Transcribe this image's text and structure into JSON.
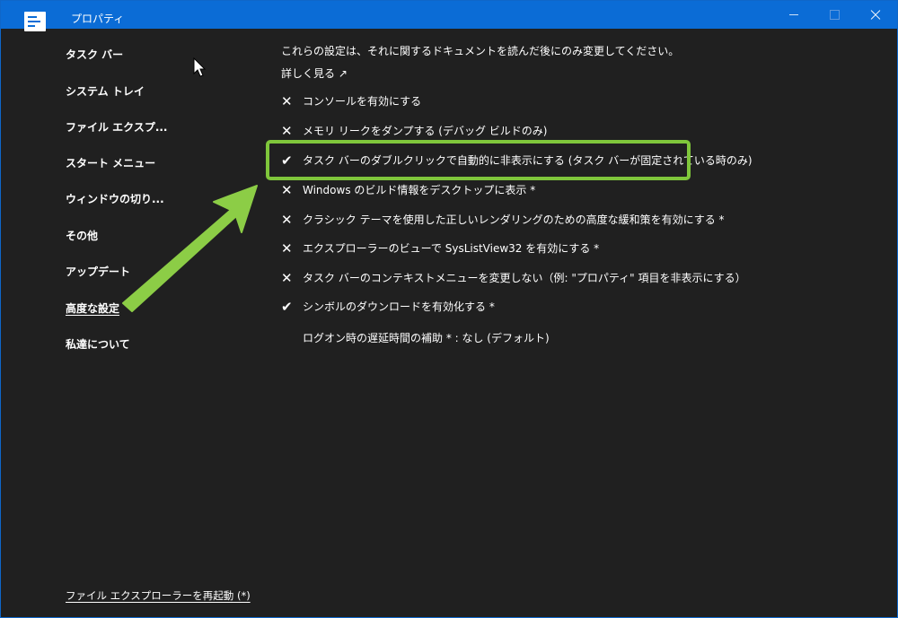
{
  "window": {
    "title": "プロパティ",
    "app_icon": "properties-app-icon",
    "controls": [
      "minimize-icon",
      "maximize-icon",
      "close-icon"
    ]
  },
  "sidebar": {
    "items": [
      {
        "label": "タスク バー"
      },
      {
        "label": "システム トレイ"
      },
      {
        "label": "ファイル エクスプ..."
      },
      {
        "label": "スタート メニュー"
      },
      {
        "label": "ウィンドウの切り..."
      },
      {
        "label": "その他"
      },
      {
        "label": "アップデート"
      },
      {
        "label": "高度な設定",
        "selected": true
      },
      {
        "label": "私達について"
      }
    ],
    "restart_link": "ファイル エクスプローラーを再起動 (*)"
  },
  "main": {
    "info": "これらの設定は、それに関するドキュメントを読んだ後にのみ変更してください。",
    "learn_more": "詳しく見る ↗",
    "options": [
      {
        "mark": "✕",
        "label": "コンソールを有効にする",
        "checked": false
      },
      {
        "mark": "✕",
        "label": "メモリ リークをダンプする (デバッグ ビルドのみ)",
        "checked": false
      },
      {
        "mark": "✔",
        "label": "タスク バーのダブルクリックで自動的に非表示にする (タスク バーが固定されている時のみ)",
        "checked": true
      },
      {
        "mark": "✕",
        "label": "Windows のビルド情報をデスクトップに表示 *",
        "checked": false
      },
      {
        "mark": "✕",
        "label": "クラシック テーマを使用した正しいレンダリングのための高度な緩和策を有効にする *",
        "checked": false
      },
      {
        "mark": "✕",
        "label": "エクスプローラーのビューで SysListView32 を有効にする *",
        "checked": false
      },
      {
        "mark": "✕",
        "label": "タスク バーのコンテキストメニューを変更しない（例: \"プロパティ\" 項目を非表示にする）",
        "checked": false
      },
      {
        "mark": "✔",
        "label": "シンボルのダウンロードを有効化する *",
        "checked": true
      }
    ],
    "logon_delay": "ログオン時の遅延時間の補助 * : なし (デフォルト)"
  },
  "annotations": {
    "highlight_color": "#7fc63b",
    "arrow_color": "#8ccd46"
  },
  "colors": {
    "titlebar": "#0b6cd6",
    "background": "#202020",
    "text": "#ffffff"
  }
}
